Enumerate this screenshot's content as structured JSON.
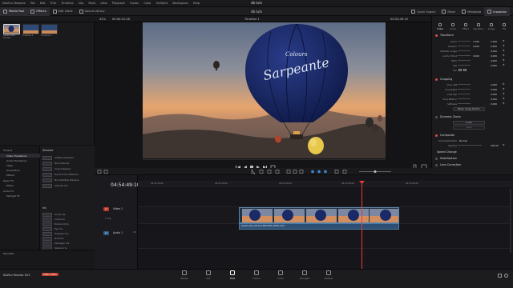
{
  "app": {
    "menu": [
      "DaVinci Resolve",
      "File",
      "Edit",
      "Trim",
      "Timeline",
      "Clip",
      "Mark",
      "View",
      "Playback",
      "Fusion",
      "Color",
      "Fairlight",
      "Workspace",
      "Help"
    ],
    "project_title": "db tuts"
  },
  "toolbar": {
    "left": [
      "Media Pool",
      "Effects",
      "Edit Index",
      "Sound Library"
    ],
    "right": [
      "Quick Export",
      "Mixer",
      "Metadata",
      "Inspector"
    ],
    "project": "db tuts"
  },
  "viewer_header": {
    "zoom": "42%",
    "source_tc": "00:04:51:26",
    "timeline_name": "Timeline 1",
    "timeline_tc": "04:54:49:10",
    "clip_name": "pexels-alex-yilmaz-19852260-2160p.mp4"
  },
  "media_pool": {
    "clips": [
      {
        "label": "pexels-alex-yilmaz..."
      },
      {
        "label": "Timeline 1"
      },
      {
        "label": "Timeline 1"
      }
    ]
  },
  "inspector": {
    "tabs": [
      "Video",
      "Audio",
      "Effect",
      "Transition",
      "Image",
      "File"
    ],
    "transform": {
      "title": "Transform",
      "rows": [
        {
          "label": "Zoom",
          "x": "1.000",
          "y": "1.000"
        },
        {
          "label": "Position",
          "x": "0.000",
          "y": "0.000"
        },
        {
          "label": "Rotation Angle",
          "x": "0.000",
          "y": ""
        },
        {
          "label": "Anchor Point",
          "x": "0.000",
          "y": "0.000"
        },
        {
          "label": "Pitch",
          "x": "0.000",
          "y": ""
        },
        {
          "label": "Yaw",
          "x": "0.000",
          "y": ""
        },
        {
          "label": "Flip",
          "x": "",
          "y": ""
        }
      ]
    },
    "cropping": {
      "title": "Cropping",
      "rows": [
        {
          "label": "Crop Left",
          "value": "0.000"
        },
        {
          "label": "Crop Right",
          "value": "0.000"
        },
        {
          "label": "Crop Top",
          "value": "0.000"
        },
        {
          "label": "Crop Bottom",
          "value": "0.000"
        },
        {
          "label": "Softness",
          "value": "0.000"
        }
      ],
      "retain": "Retain Image Position"
    },
    "dynamic_zoom": {
      "title": "Dynamic Zoom",
      "ease": "Linear",
      "swap": "Swap"
    },
    "composite": {
      "title": "Composite",
      "rows": [
        {
          "label": "Composite Mode",
          "value": "Normal"
        },
        {
          "label": "Opacity",
          "value": "100.00"
        }
      ]
    },
    "collapsed": [
      "Speed Change",
      "Stabilization",
      "Lens Correction"
    ]
  },
  "effects": {
    "tree": [
      "Toolbox",
      "Video Transitions",
      "Audio Transitions",
      "Titles",
      "Generators",
      "Effects",
      "Open FX",
      "Filters",
      "Audio FX",
      "Fairlight FX"
    ],
    "selected": "Video Transitions",
    "list_title": "Dissolve",
    "dissolve": [
      "Additive Dissolve",
      "Blur Dissolve",
      "Cross Dissolve",
      "Dip To Color Dissolve",
      "Non-Additive Dissolve",
      "Smooth Cut"
    ],
    "iris_title": "Iris",
    "iris": [
      "Arrow Iris",
      "Cross Iris",
      "Diamond Iris",
      "Eye Iris",
      "Hexagon Iris",
      "Oval Iris",
      "Pentagon Iris",
      "Square Iris"
    ],
    "favorites": "Favorites"
  },
  "timeline": {
    "timecode": "04:54:49:10",
    "ruler": [
      "04:54:20:00",
      "04:54:30:00",
      "04:54:40:00",
      "04:54:50:00",
      "04:55:00:00"
    ],
    "tracks": [
      {
        "id": "V1",
        "name": "Video 1",
        "meta": "1 Clip"
      },
      {
        "id": "A1",
        "name": "Audio 1",
        "meta": "2.0"
      }
    ],
    "audio_clip": "pexels-alex-yilmaz-19852260-2160p.mp4"
  },
  "pages": [
    "Media",
    "Cut",
    "Edit",
    "Fusion",
    "Color",
    "Fairlight",
    "Deliver"
  ],
  "active_page": "Edit",
  "status": {
    "product": "DaVinci Resolve 18.5",
    "badge": "PUBLIC BETA"
  },
  "colors": {
    "accent": "#e23b3b",
    "clip_blue": "#2c4f73",
    "video_track": "#c0392b",
    "balloon": "#1a2a66"
  }
}
